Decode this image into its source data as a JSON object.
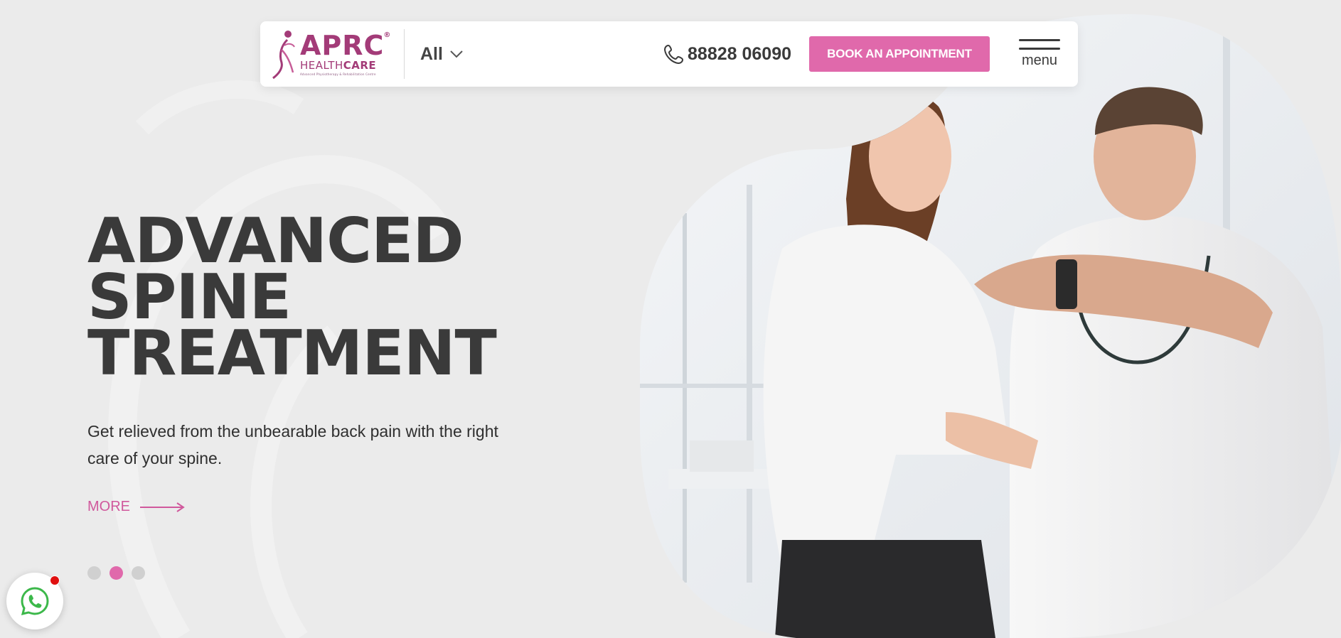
{
  "header": {
    "logo": {
      "brand": "APRC",
      "brand_mark": "®",
      "sub_prefix": "HEALTH",
      "sub_suffix": "CARE",
      "tagline": "Advanced Physiotherapy & Rehabilitation Centre"
    },
    "category_select": {
      "selected": "All"
    },
    "phone": "88828 06090",
    "book_button": "BOOK AN APPOINTMENT",
    "menu_label": "menu"
  },
  "hero": {
    "title_lines": [
      "ADVANCED",
      "SPINE",
      "TREATMENT"
    ],
    "subtitle": "Get relieved from the unbearable back pain with the right care of your spine.",
    "more_label": "MORE",
    "slides": {
      "count": 3,
      "active_index": 1
    }
  },
  "icons": {
    "phone": "phone-icon",
    "chevron": "chevron-down-icon",
    "menu": "hamburger-icon",
    "arrow": "arrow-right-icon",
    "whatsapp": "whatsapp-icon"
  },
  "colors": {
    "accent": "#e069ab",
    "brand": "#a33b78",
    "text": "#3a3a3a",
    "background": "#ebebeb",
    "whatsapp": "#3cb84a",
    "notification": "#e01010"
  }
}
